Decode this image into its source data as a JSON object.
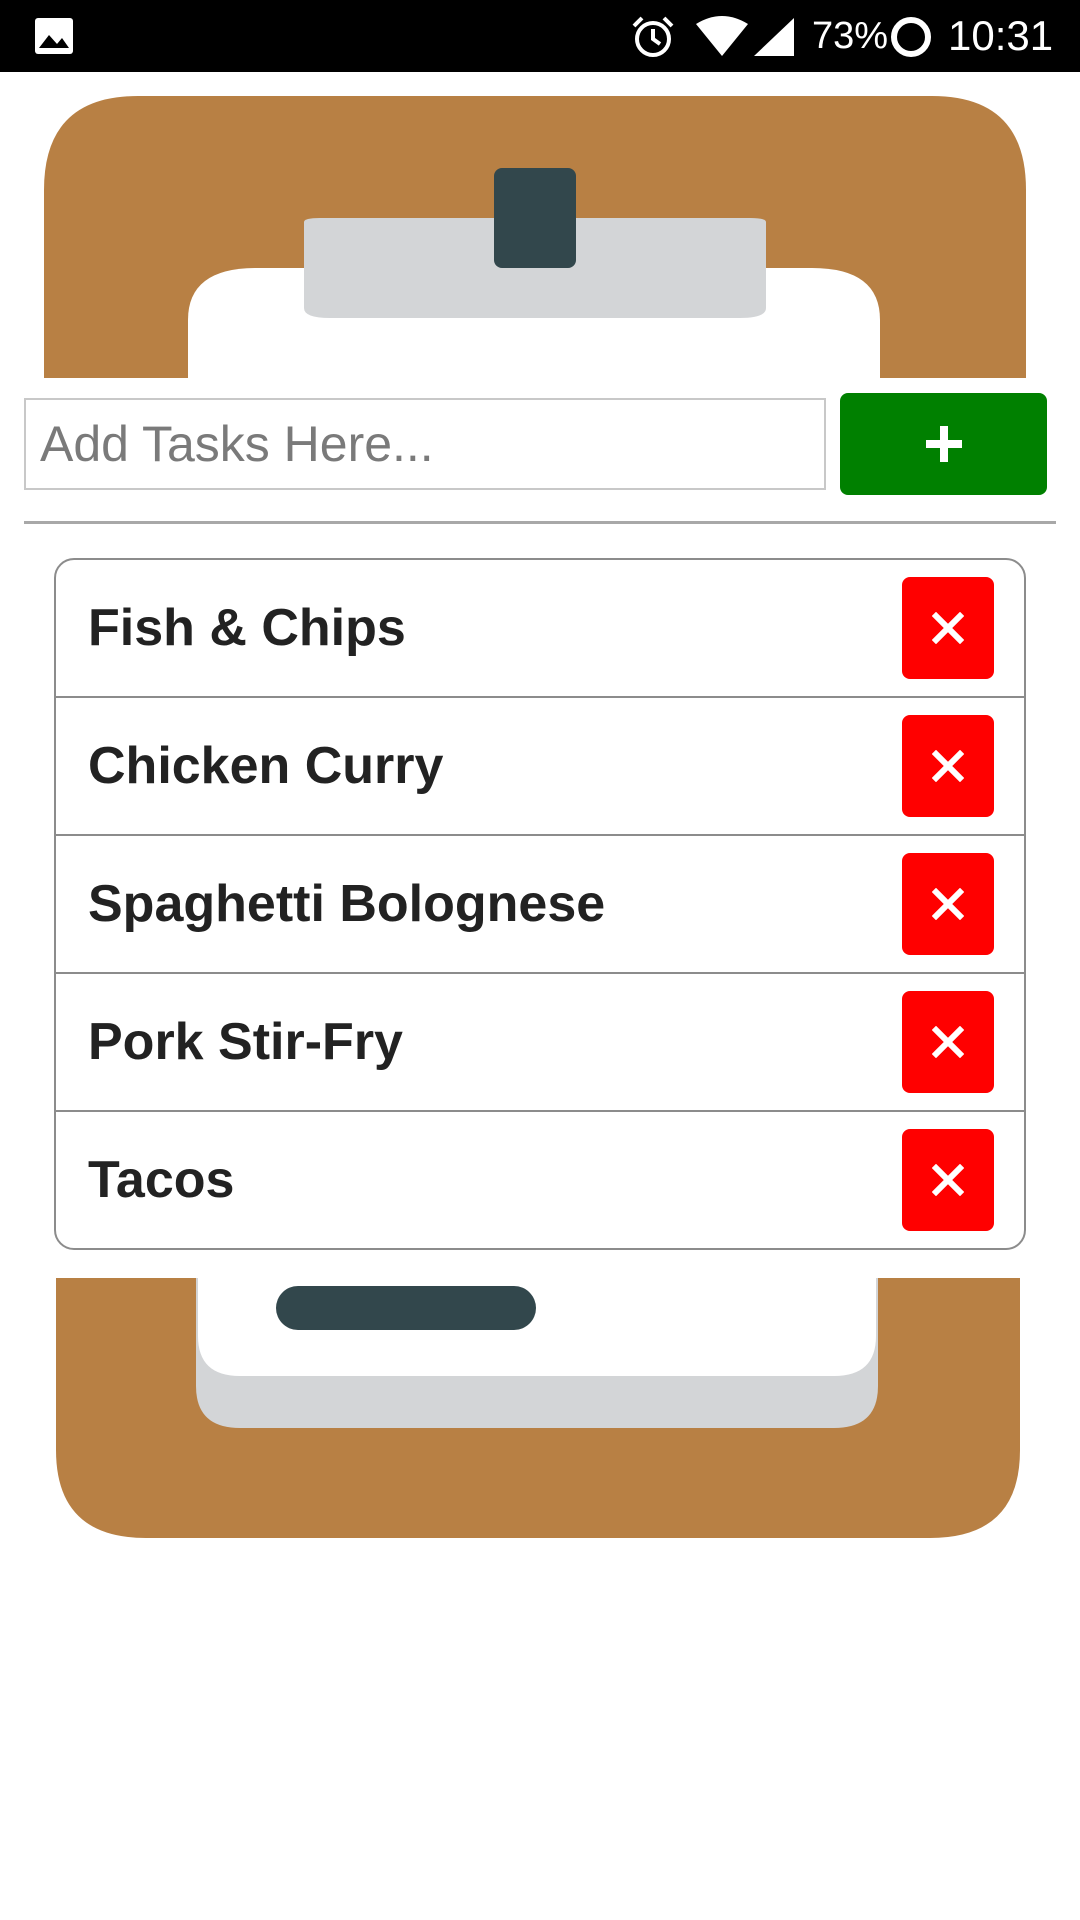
{
  "status_bar": {
    "battery_percent": "73%",
    "time": "10:31",
    "icons": [
      "gallery-icon",
      "alarm-icon",
      "wifi-icon",
      "signal-icon",
      "battery-icon"
    ]
  },
  "input": {
    "placeholder": "Add Tasks Here...",
    "value": ""
  },
  "add_button": {
    "icon": "plus-icon",
    "color": "#008000"
  },
  "tasks": [
    {
      "label": "Fish & Chips"
    },
    {
      "label": "Chicken Curry"
    },
    {
      "label": "Spaghetti Bolognese"
    },
    {
      "label": "Pork Stir-Fry"
    },
    {
      "label": "Tacos"
    }
  ],
  "delete_button": {
    "icon": "close-icon",
    "color": "#ff0000"
  },
  "colors": {
    "clipboard_board": "#b88044",
    "clipboard_clip": "#d3d5d7",
    "clip_dark": "#32474c"
  }
}
